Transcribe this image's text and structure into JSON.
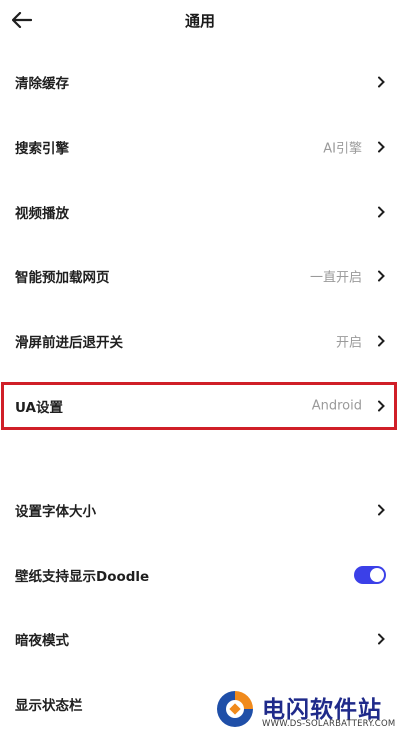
{
  "header": {
    "title": "通用"
  },
  "settings": {
    "clear_cache": {
      "label": "清除缓存"
    },
    "search_engine": {
      "label": "搜索引擎",
      "value": "AI引擎"
    },
    "video_playback": {
      "label": "视频播放"
    },
    "smart_preload": {
      "label": "智能预加载网页",
      "value": "一直开启"
    },
    "swipe_nav": {
      "label": "滑屏前进后退开关",
      "value": "开启"
    },
    "ua_settings": {
      "label": "UA设置",
      "value": "Android"
    },
    "font_size": {
      "label": "设置字体大小"
    },
    "wallpaper_doodle": {
      "label": "壁纸支持显示Doodle",
      "enabled": true
    },
    "dark_mode": {
      "label": "暗夜模式"
    },
    "status_bar": {
      "label": "显示状态栏"
    }
  },
  "colors": {
    "highlight_border": "#d01f28",
    "toggle_on": "#3b40e8"
  },
  "watermark": {
    "name": "电闪软件站",
    "url": "WWW.DS-SOLARBATTERY.COM"
  }
}
